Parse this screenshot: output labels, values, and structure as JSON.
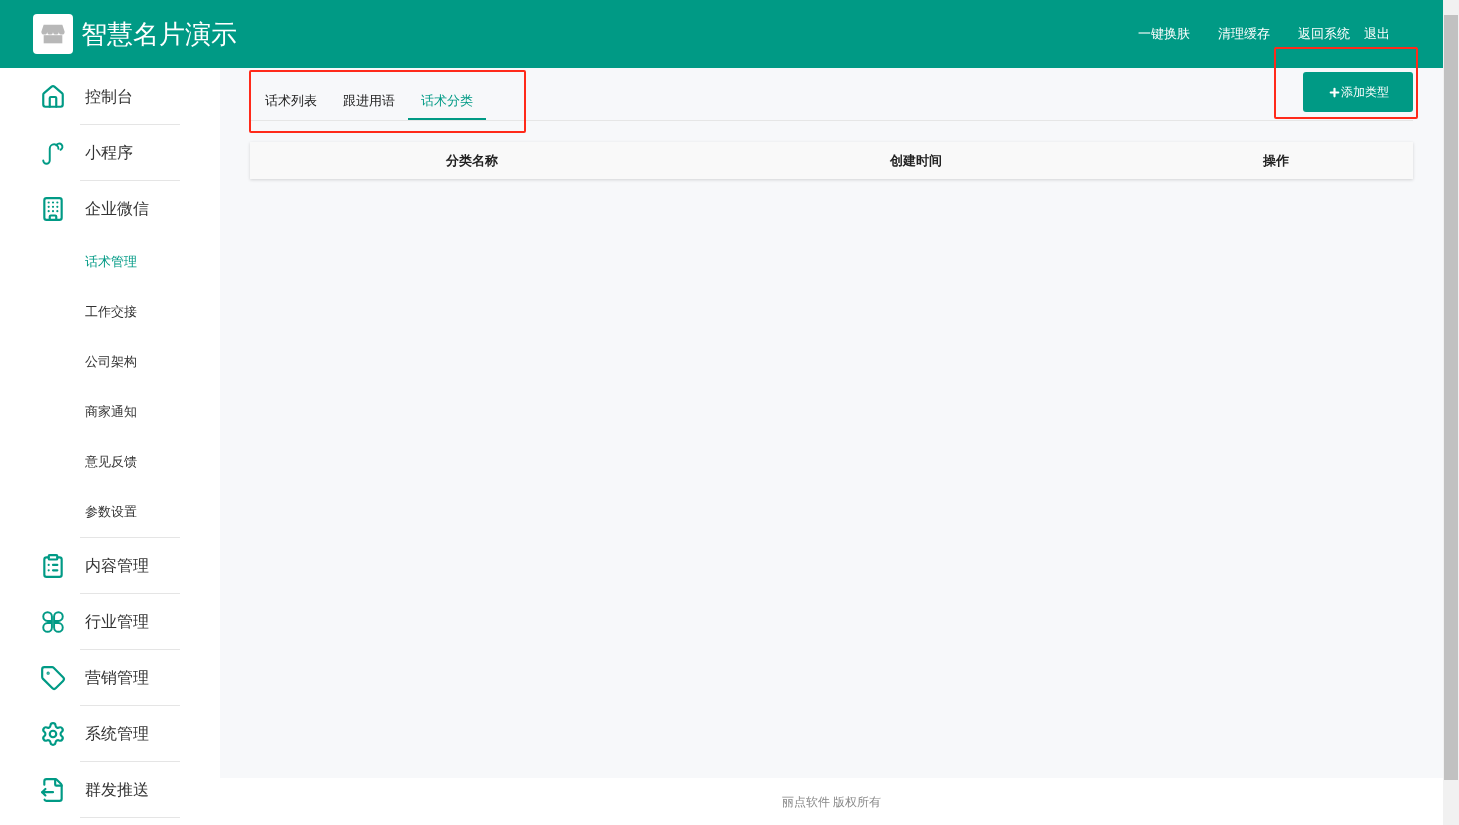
{
  "header": {
    "title": "智慧名片演示",
    "links": [
      "一键换肤",
      "清理缓存",
      "返回系统",
      "退出"
    ]
  },
  "sidebar": {
    "items": [
      {
        "label": "控制台",
        "selected": false
      },
      {
        "label": "小程序",
        "selected": false
      },
      {
        "label": "企业微信",
        "selected": false,
        "children": [
          {
            "label": "话术管理",
            "selected": true
          },
          {
            "label": "工作交接",
            "selected": false
          },
          {
            "label": "公司架构",
            "selected": false
          },
          {
            "label": "商家通知",
            "selected": false
          },
          {
            "label": "意见反馈",
            "selected": false
          },
          {
            "label": "参数设置",
            "selected": false
          }
        ]
      },
      {
        "label": "内容管理",
        "selected": false
      },
      {
        "label": "行业管理",
        "selected": false
      },
      {
        "label": "营销管理",
        "selected": false
      },
      {
        "label": "系统管理",
        "selected": false
      },
      {
        "label": "群发推送",
        "selected": false
      }
    ]
  },
  "tabs": [
    {
      "label": "话术列表",
      "selected": false
    },
    {
      "label": "跟进用语",
      "selected": false
    },
    {
      "label": "话术分类",
      "selected": true
    }
  ],
  "add_button": {
    "label": "添加类型"
  },
  "table": {
    "columns": [
      "分类名称",
      "创建时间",
      "操作"
    ]
  },
  "footer": {
    "text": "丽点软件 版权所有"
  }
}
